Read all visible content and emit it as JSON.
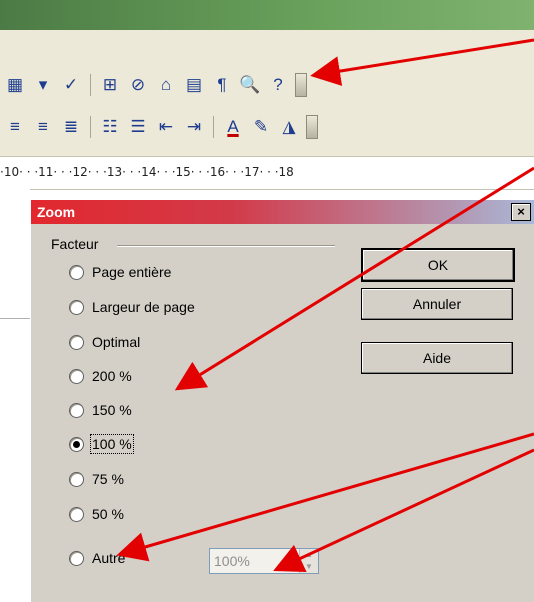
{
  "toolbar_row1": {
    "icons": [
      "grid-icon",
      "dropdown-icon",
      "check-pen-icon",
      "binoculars-icon",
      "navigator-icon",
      "gallery-icon",
      "data-sources-icon",
      "pilcrow-icon",
      "zoom-icon",
      "help-icon"
    ]
  },
  "toolbar_row2": {
    "icons": [
      "align-center-icon",
      "align-right-icon",
      "justify-icon",
      "numbering-icon",
      "bullets-icon",
      "decrease-indent-icon",
      "increase-indent-icon",
      "font-color-icon",
      "highlight-icon",
      "background-color-icon"
    ]
  },
  "ruler": {
    "text": "·10· · ·11· · ·12· · ·13· · ·14· · ·15· · ·16· · ·17· · ·18"
  },
  "dialog": {
    "title": "Zoom",
    "close": "×",
    "group_label": "Facteur",
    "options": [
      {
        "label": "Page entière",
        "selected": false
      },
      {
        "label": "Largeur de page",
        "selected": false
      },
      {
        "label": "Optimal",
        "selected": false
      },
      {
        "label": "200 %",
        "selected": false
      },
      {
        "label": "150 %",
        "selected": false
      },
      {
        "label": "100 %",
        "selected": true
      },
      {
        "label": "75 %",
        "selected": false
      },
      {
        "label": "50 %",
        "selected": false
      },
      {
        "label": "Autre",
        "selected": false
      }
    ],
    "buttons": {
      "ok": "OK",
      "cancel": "Annuler",
      "help": "Aide"
    },
    "custom_value": "100%"
  },
  "colors": {
    "annotation_arrow": "#e30000",
    "title_gradient_start": "#e2282e",
    "dialog_bg": "#d4d0c8"
  }
}
